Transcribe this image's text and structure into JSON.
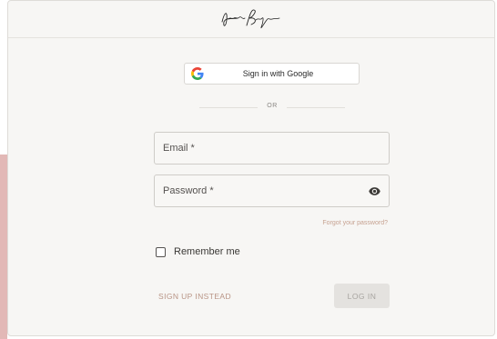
{
  "header": {
    "logo_icon": "signature-logo"
  },
  "google_signin": {
    "label": "Sign in with Google",
    "icon": "google-g-icon"
  },
  "divider": {
    "text": "OR"
  },
  "form": {
    "email_placeholder": "Email *",
    "password_placeholder": "Password *",
    "password_toggle_icon": "eye-icon",
    "forgot_password": "Forgot your password?",
    "remember_me": "Remember me",
    "remember_checked": false
  },
  "actions": {
    "signup": "SIGN UP INSTEAD",
    "login": "LOG IN"
  },
  "colors": {
    "accent": "#c6a190",
    "side_strip": "#e2b8b6",
    "background": "#f7f6f4"
  }
}
